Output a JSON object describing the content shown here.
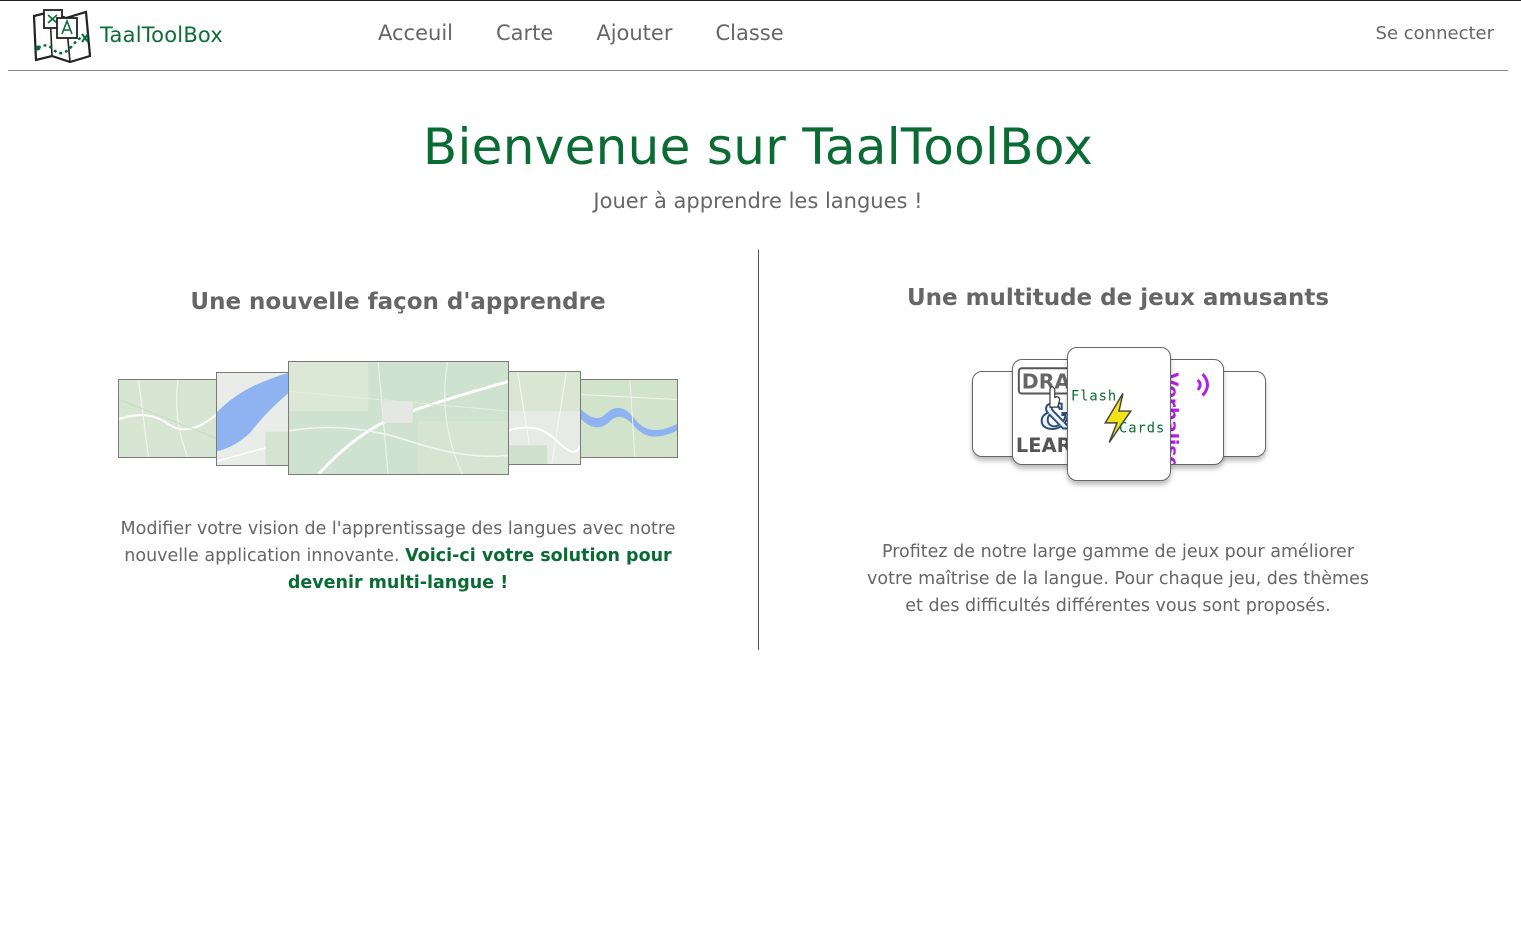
{
  "brand": {
    "name": "TaalToolBox"
  },
  "nav": {
    "items": [
      {
        "label": "Acceuil"
      },
      {
        "label": "Carte"
      },
      {
        "label": "Ajouter"
      },
      {
        "label": "Classe"
      }
    ],
    "login_label": "Se connecter"
  },
  "hero": {
    "title": "Bienvenue sur TaalToolBox",
    "subtitle": "Jouer à apprendre les langues !"
  },
  "left": {
    "title": "Une nouvelle façon d'apprendre",
    "text_plain": "Modifier votre vision de l'apprentissage des langues avec notre nouvelle application innovante. ",
    "text_accent": "Voici-ci votre solution pour devenir multi-langue !"
  },
  "right": {
    "title": "Une multitude de jeux amusants",
    "text": "Profitez de notre large gamme de jeux pour améliorer votre maîtrise de la langue. Pour chaque jeu, des thèmes et des difficultés différentes vous sont proposés.",
    "cards": {
      "drag_top": "DRA",
      "drag_amp": "&",
      "drag_bottom": "LEAR",
      "flash_top": "Flash",
      "flash_bottom": "Cards",
      "verbalise": "Verbalise"
    }
  },
  "colors": {
    "accent": "#0a6c34",
    "text": "#666666",
    "verbalise": "#b21ee6"
  }
}
